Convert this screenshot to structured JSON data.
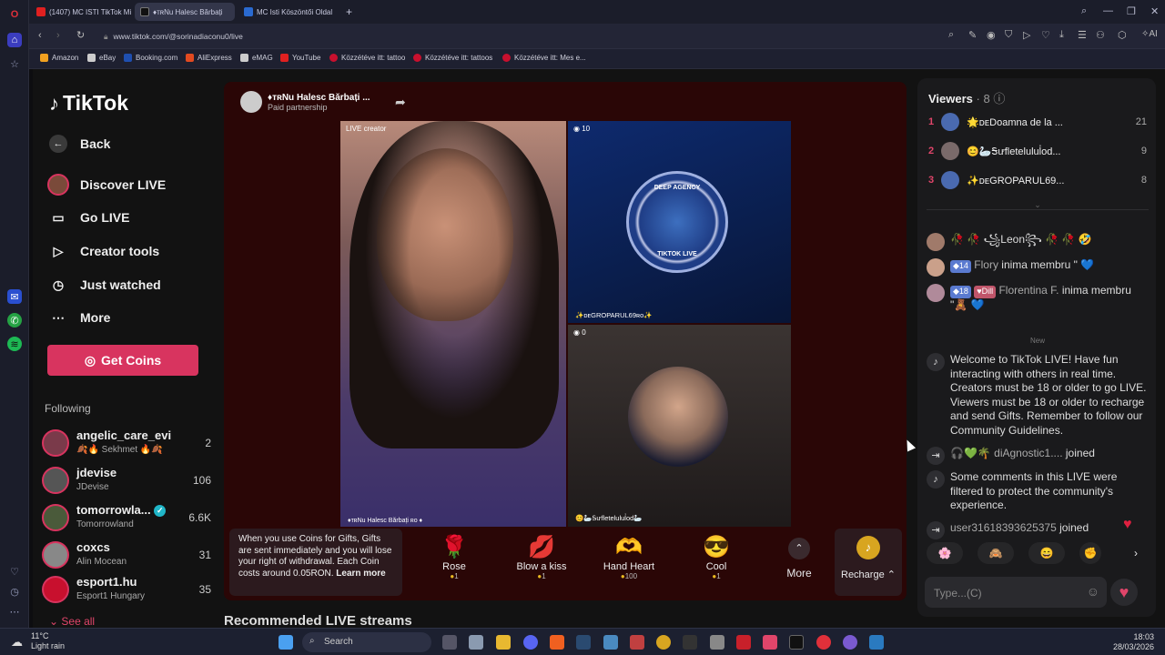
{
  "browser": {
    "tabs": [
      {
        "label": "(1407) MC ISTI TikTok Mi"
      },
      {
        "label": "♦тʀNu Halesc Bărbați"
      },
      {
        "label": "MC Isti Köszöntői Oldal"
      }
    ],
    "url": "www.tiktok.com/@sorinadiaconu0/live",
    "bookmarks": [
      "Amazon",
      "eBay",
      "Booking.com",
      "AliExpress",
      "eMAG",
      "YouTube",
      "Közzétéve itt: tattoo",
      "Közzétéve itt: tattoos",
      "Közzétéve itt: Mes e..."
    ]
  },
  "nav": {
    "logo": "TikTok",
    "back": "Back",
    "items": [
      "Discover LIVE",
      "Go LIVE",
      "Creator tools",
      "Just watched",
      "More"
    ],
    "get_coins": "Get Coins",
    "following_title": "Following",
    "following": [
      {
        "name": "angelic_care_evi",
        "sub": "🍂🔥 Sekhmet 🔥🍂",
        "count": "2"
      },
      {
        "name": "jdevise",
        "sub": "JDevise",
        "count": "106"
      },
      {
        "name": "tomorrowla...",
        "sub": "Tomorrowland",
        "count": "6.6K"
      },
      {
        "name": "coxcs",
        "sub": "Alin Mocean",
        "count": "31"
      },
      {
        "name": "esport1.hu",
        "sub": "Esport1 Hungary",
        "count": "35"
      }
    ],
    "see_all": "See all"
  },
  "stream": {
    "host_name": "♦тʀNu Halesc Bărbați ...",
    "host_sub": "Paid partnership",
    "main_label": "LIVE creator",
    "main_bottom": "♦тʀNu Halesc Bărbați ʀᴏ ♦",
    "top_count": "10",
    "top_name": "✨ᴅᴇGROPARUL69ʀᴏ✨",
    "agency_top": "DEEP AGENCY",
    "agency_bottom": "TIKTOK LIVE",
    "bot_count": "0",
    "bot_name": "😊🦢Ꭶưfletelulul҆od🦢"
  },
  "gifts": {
    "info": "When you use Coins for Gifts, Gifts are sent immediately and you will lose your right of withdrawal. Each Coin costs around 0.05RON.",
    "learn_more": "Learn more",
    "items": [
      {
        "name": "Rose",
        "price": "1",
        "icon": "🌹"
      },
      {
        "name": "Blow a kiss",
        "price": "1",
        "icon": "💋"
      },
      {
        "name": "Hand Heart",
        "price": "100",
        "icon": "🫶"
      },
      {
        "name": "Cool",
        "price": "1",
        "icon": "😎"
      }
    ],
    "more": "More",
    "recharge": "Recharge"
  },
  "recommended": "Recommended LIVE streams",
  "chat": {
    "viewers_title": "Viewers",
    "viewers_count": "· 8",
    "viewers": [
      {
        "rank": "1",
        "name": "🌟ᴅᴇDoamna de la ...",
        "score": "21"
      },
      {
        "rank": "2",
        "name": "😊🦢Ꭶưfletelulul҆od...",
        "score": "9"
      },
      {
        "rank": "3",
        "name": "✨ᴅᴇGROPARUL69...",
        "score": "8"
      }
    ],
    "msg_leon": "🥀 🥀 ꧁Leon꧂ 🥀 🥀 🤣",
    "msg_flory_badge": "14",
    "msg_flory_name": "Flory",
    "msg_flory_text": "inima membru \" 💙",
    "msg_flor_badge": "18",
    "msg_flor_badge2": "Dill",
    "msg_flor_name": "Florentina F.",
    "msg_flor_text": "inima membru \"🧸 💙",
    "new_label": "New",
    "welcome": "Welcome to TikTok LIVE! Have fun interacting with others in real time. Creators must be 18 or older to go LIVE. Viewers must be 18 or older to recharge and send Gifts. Remember to follow our Community Guidelines.",
    "joined1_name": "🎧💚🌴 diAgnostic1....",
    "joined1_text": "joined",
    "filtered": "Some comments in this LIVE were filtered to protect the community's experience.",
    "joined2_name": "user31618393625375",
    "joined2_text": "joined",
    "input_placeholder": "Type...(C)"
  },
  "taskbar": {
    "temp": "11°C",
    "weather": "Light rain",
    "search": "Search",
    "time": "18:03",
    "date": "28/03/2026"
  }
}
